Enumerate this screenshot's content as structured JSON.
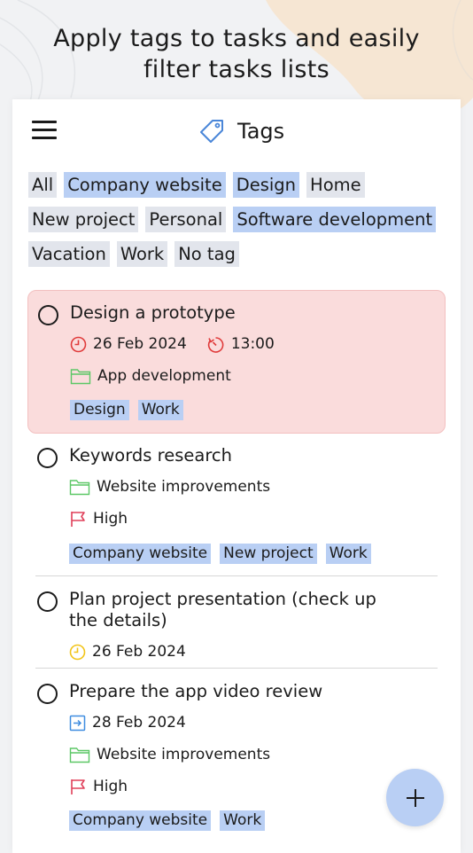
{
  "headline": {
    "line1": "Apply tags to tasks and easily",
    "line2": "filter tasks lists"
  },
  "colors": {
    "selected_chip": "#b9cff4",
    "unselected_chip": "#e2e5ec",
    "highlight_task": "#fadcdc",
    "red_icon": "#e03b3b",
    "green_icon": "#5cc766",
    "yellow_icon": "#f2c418",
    "blue_icon": "#3f8de0"
  },
  "topbar": {
    "menu_icon": "hamburger-icon",
    "title_icon": "tag-icon",
    "title": "Tags"
  },
  "filters": {
    "rows": [
      [
        {
          "label": "All",
          "selected": false
        },
        {
          "label": "Company website",
          "selected": true
        },
        {
          "label": "Design",
          "selected": true
        },
        {
          "label": "Home",
          "selected": false
        }
      ],
      [
        {
          "label": "New project",
          "selected": false
        },
        {
          "label": "Personal",
          "selected": false
        },
        {
          "label": "Software development",
          "selected": true
        }
      ],
      [
        {
          "label": "Vacation",
          "selected": false
        },
        {
          "label": "Work",
          "selected": false
        },
        {
          "label": "No tag",
          "selected": false
        }
      ]
    ]
  },
  "tasks": [
    {
      "title": "Design a prototype",
      "highlighted": true,
      "date": "26 Feb 2024",
      "date_icon": "clock-icon",
      "time": "13:00",
      "time_icon": "timer-icon",
      "project": "App development",
      "project_icon": "folder-icon",
      "tags": [
        "Design",
        "Work"
      ]
    },
    {
      "title": "Keywords research",
      "highlighted": false,
      "project": "Website improvements",
      "project_icon": "folder-icon",
      "priority": "High",
      "priority_icon": "flag-icon",
      "tags": [
        "Company website",
        "New project",
        "Work"
      ]
    },
    {
      "title": "Plan project presentation (check up the details)",
      "highlighted": false,
      "date": "26 Feb 2024",
      "date_icon": "clock-icon",
      "tags": []
    },
    {
      "title": "Prepare the app video review",
      "highlighted": false,
      "date": "28 Feb 2024",
      "date_icon": "calendar-arrow-icon",
      "project": "Website improvements",
      "project_icon": "folder-icon",
      "priority": "High",
      "priority_icon": "flag-icon",
      "tags": [
        "Company website",
        "Work"
      ]
    }
  ],
  "fab": {
    "icon": "plus-icon"
  }
}
